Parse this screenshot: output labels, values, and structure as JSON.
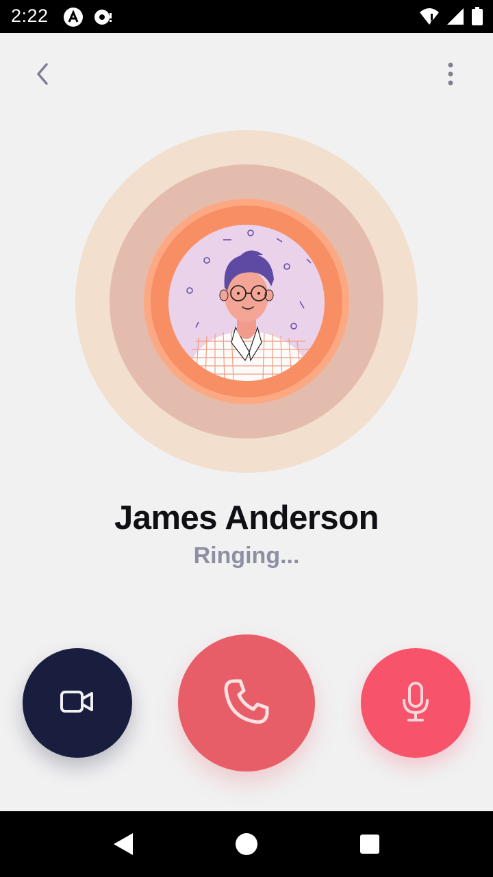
{
  "status_bar": {
    "time": "2:22",
    "icons_left": [
      "app-a-icon",
      "media-icon"
    ],
    "icons_right": [
      "wifi-icon",
      "signal-icon",
      "battery-icon"
    ]
  },
  "top_bar": {
    "back_icon": "chevron-left-icon",
    "menu_icon": "more-vertical-icon"
  },
  "caller": {
    "name": "James Anderson",
    "status": "Ringing..."
  },
  "actions": {
    "video_icon": "video-camera-icon",
    "call_icon": "phone-icon",
    "mic_icon": "microphone-icon"
  },
  "colors": {
    "background": "#f1f1f2",
    "ring_outer": "#f2dfcd",
    "ring_middle": "#e4bcad",
    "ring_inner": "#f88e63",
    "video_button": "#1a1e3e",
    "call_button": "#e85e68",
    "mic_button": "#f7536a",
    "status_text": "#8e8fa3"
  },
  "nav_bar": {
    "buttons": [
      "back-triangle-icon",
      "home-circle-icon",
      "recents-square-icon"
    ]
  }
}
